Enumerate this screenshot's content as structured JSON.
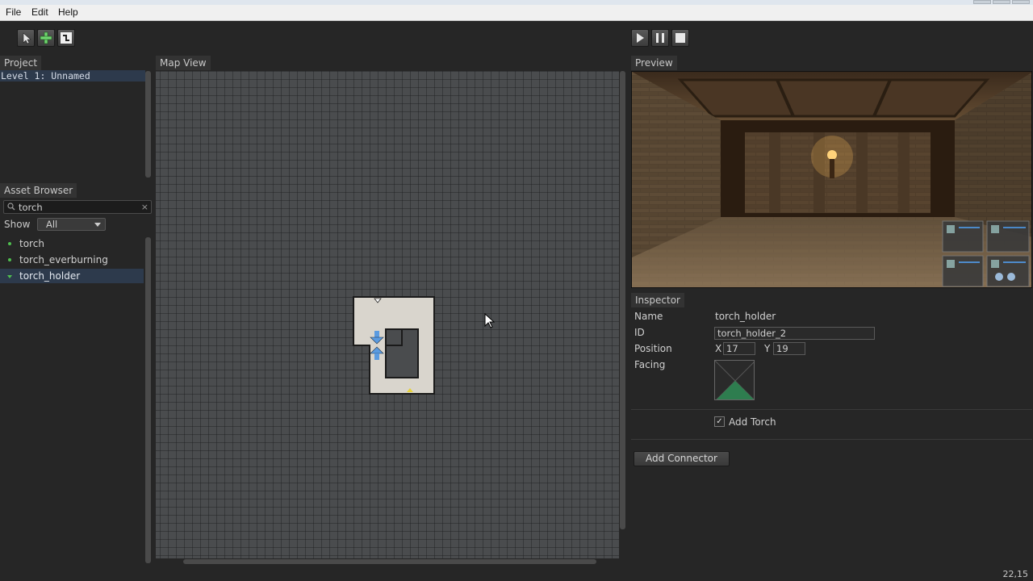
{
  "menu": {
    "file": "File",
    "edit": "Edit",
    "help": "Help"
  },
  "panels": {
    "project": "Project",
    "asset_browser": "Asset Browser",
    "map_view": "Map View",
    "preview": "Preview",
    "inspector": "Inspector"
  },
  "project": {
    "levels": [
      "Level 1: Unnamed"
    ]
  },
  "assets": {
    "search_value": "torch",
    "clear_symbol": "×",
    "show_label": "Show",
    "show_value": "All",
    "items": [
      "torch",
      "torch_everburning",
      "torch_holder"
    ],
    "selected_item": "torch_holder"
  },
  "inspector": {
    "name_label": "Name",
    "name_value": "torch_holder",
    "id_label": "ID",
    "id_value": "torch_holder_2",
    "position_label": "Position",
    "x_label": "X",
    "x_value": "17",
    "y_label": "Y",
    "y_value": "19",
    "facing_label": "Facing",
    "add_torch_label": "Add Torch",
    "add_torch_checked": true,
    "check_mark": "✓",
    "add_connector_label": "Add Connector"
  },
  "status": {
    "coords": "22,15"
  },
  "colors": {
    "background": "#262626",
    "selection": "#2d3a4c",
    "map_floor": "#d8d4cc",
    "facing_green": "#2e7d4f",
    "accent_blue": "#4a90d9"
  },
  "icons": {
    "toolbar_left": [
      "select-arrow-icon",
      "add-plus-icon",
      "paint-tile-icon"
    ],
    "toolbar_right": [
      "play-icon",
      "pause-icon",
      "stop-icon"
    ],
    "search": "search-icon"
  }
}
